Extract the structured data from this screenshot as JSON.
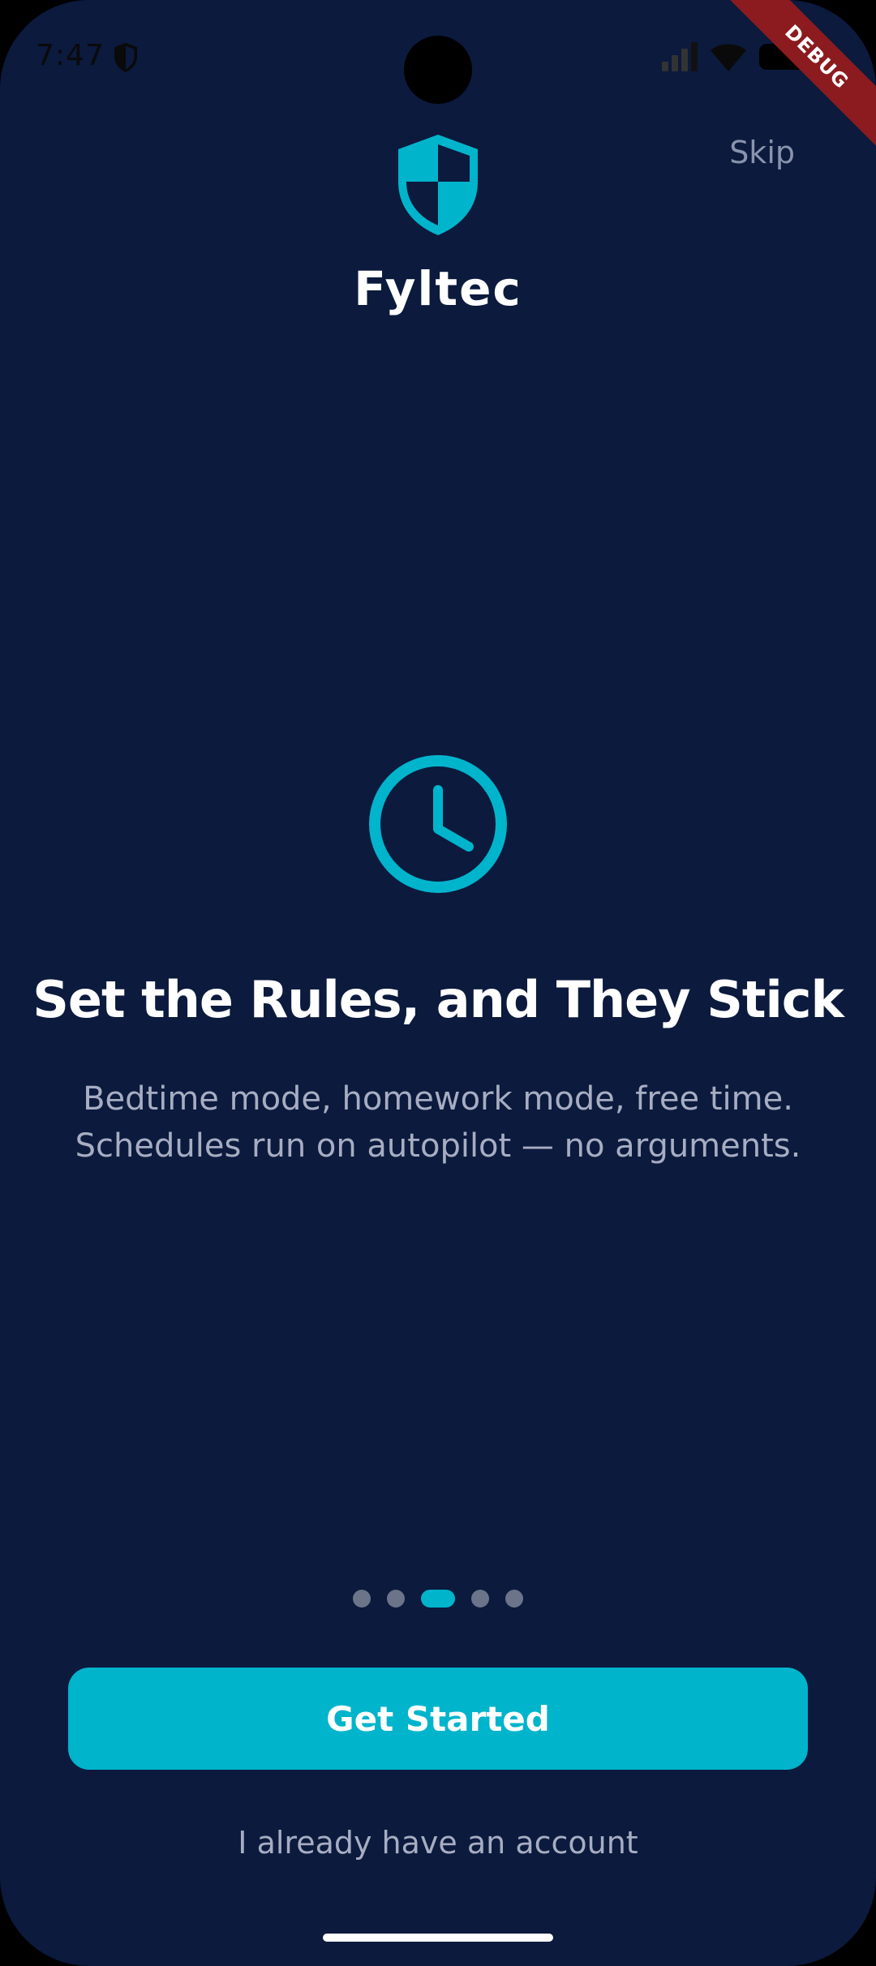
{
  "status_bar": {
    "time": "7:47",
    "icons": [
      "shield-icon",
      "signal-icon",
      "wifi-icon",
      "battery-icon"
    ]
  },
  "debug_banner": "DEBUG",
  "header": {
    "skip_label": "Skip",
    "brand_name": "Fyltec",
    "logo_icon": "shield-icon"
  },
  "slide": {
    "icon": "clock-icon",
    "title": "Set the Rules, and They Stick",
    "description": "Bedtime mode, homework mode, free time. Schedules run on autopilot — no arguments."
  },
  "pagination": {
    "count": 5,
    "active_index": 2
  },
  "actions": {
    "primary_label": "Get Started",
    "secondary_label": "I already have an account"
  },
  "colors": {
    "background": "#0b1a3d",
    "accent": "#00b4cc",
    "text_primary": "#ffffff",
    "text_secondary": "#a7adc2"
  }
}
